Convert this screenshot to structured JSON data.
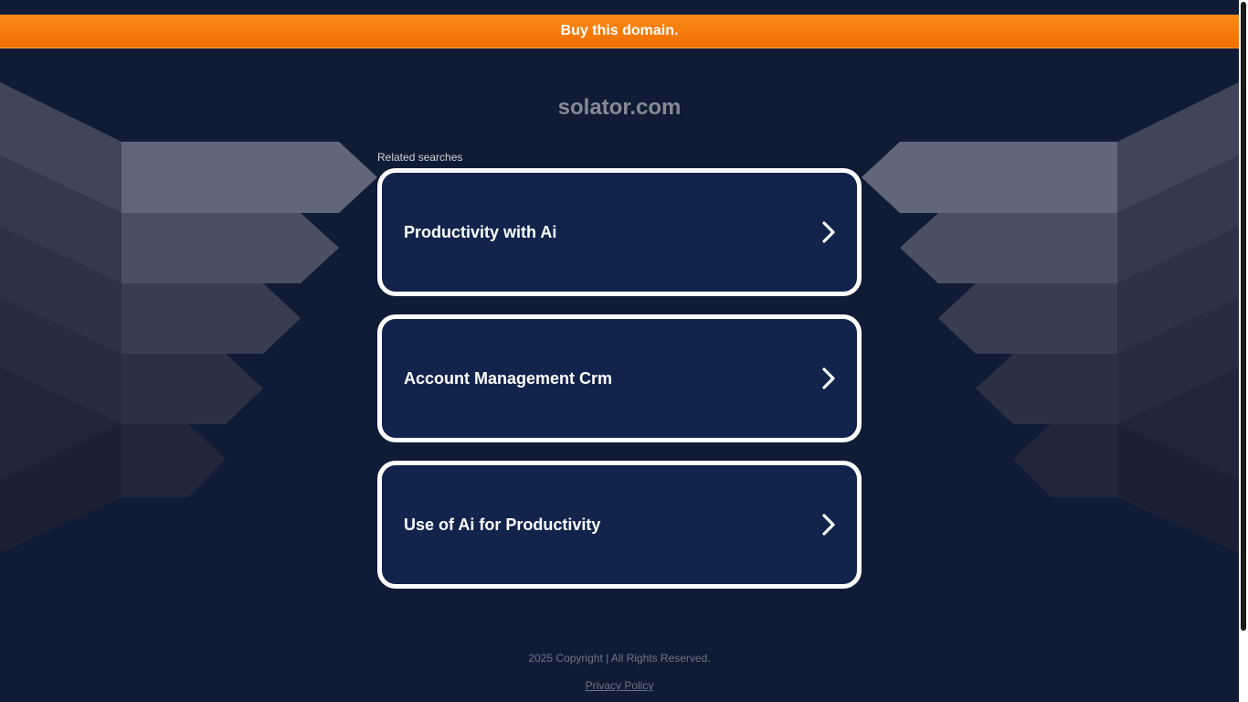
{
  "banner": {
    "label": "Buy this domain."
  },
  "domain": {
    "name": "solator.com"
  },
  "related": {
    "label": "Related searches",
    "items": [
      {
        "label": "Productivity with Ai"
      },
      {
        "label": "Account Management Crm"
      },
      {
        "label": "Use of Ai for Productivity"
      }
    ]
  },
  "icons": {
    "chevron": "chevron-right-icon"
  },
  "footer": {
    "copyright": "2025 Copyright | All Rights Reserved.",
    "privacy": "Privacy Policy"
  },
  "colors": {
    "background": "#101c36",
    "banner_orange": "#f47a07",
    "card_fill": "#12244c",
    "card_border": "#ffffff",
    "title_gray": "#878a93"
  }
}
